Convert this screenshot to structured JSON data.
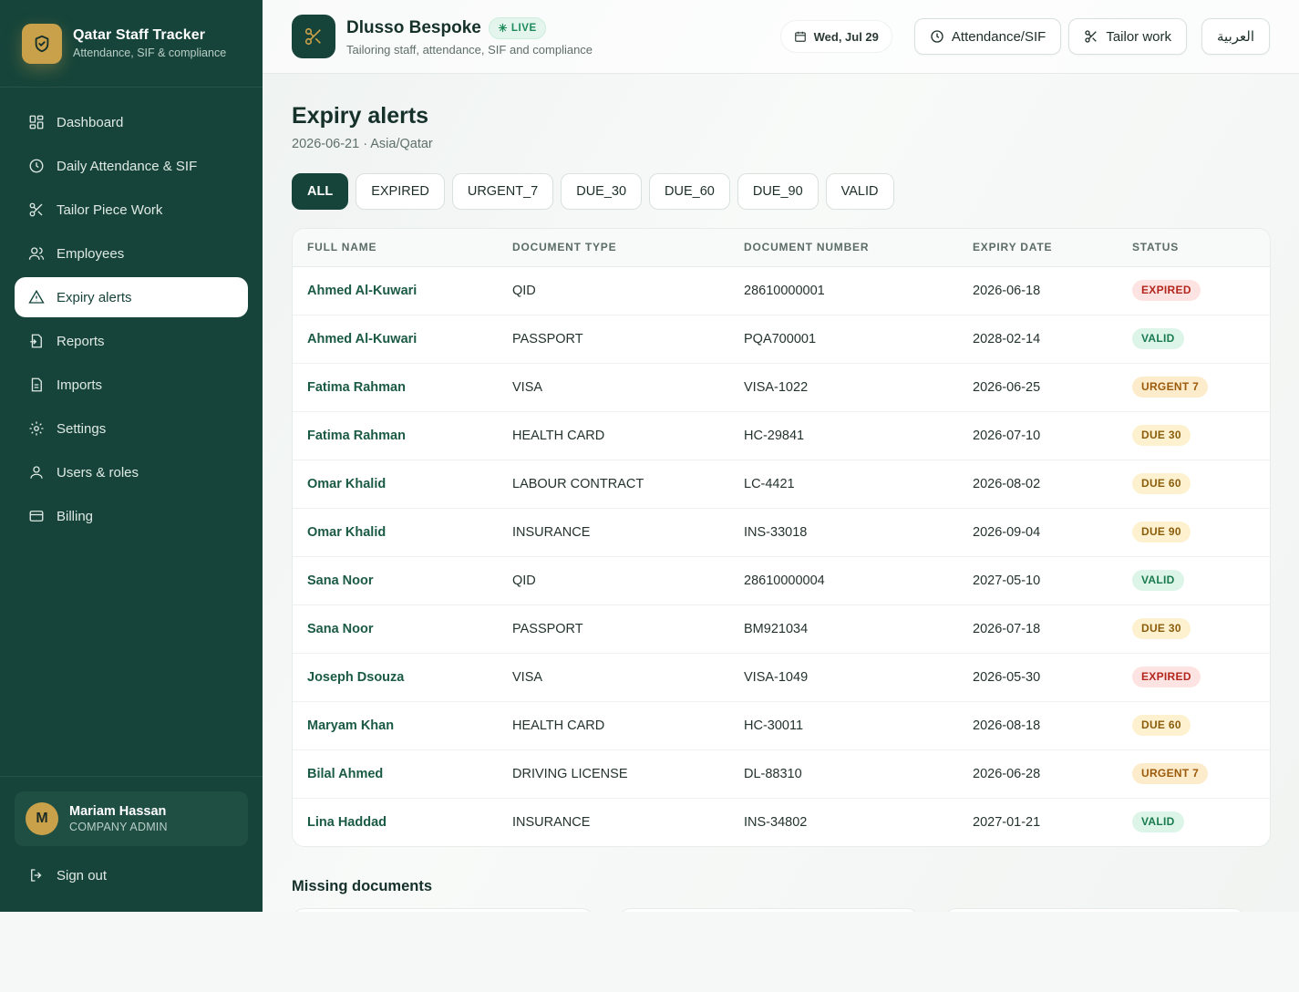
{
  "brand": {
    "title": "Qatar Staff Tracker",
    "subtitle": "Attendance, SIF & compliance"
  },
  "nav": [
    {
      "label": "Dashboard",
      "icon": "dashboard-icon",
      "active": false
    },
    {
      "label": "Daily Attendance & SIF",
      "icon": "clock-icon",
      "active": false
    },
    {
      "label": "Tailor Piece Work",
      "icon": "scissors-icon",
      "active": false
    },
    {
      "label": "Employees",
      "icon": "users-icon",
      "active": false
    },
    {
      "label": "Expiry alerts",
      "icon": "alert-triangle-icon",
      "active": true
    },
    {
      "label": "Reports",
      "icon": "report-icon",
      "active": false
    },
    {
      "label": "Imports",
      "icon": "import-icon",
      "active": false
    },
    {
      "label": "Settings",
      "icon": "gear-icon",
      "active": false
    },
    {
      "label": "Users & roles",
      "icon": "user-icon",
      "active": false
    },
    {
      "label": "Billing",
      "icon": "credit-card-icon",
      "active": false
    }
  ],
  "user": {
    "initial": "M",
    "name": "Mariam Hassan",
    "role": "COMPANY ADMIN",
    "signout": "Sign out"
  },
  "tenant": {
    "name": "Dlusso Bespoke",
    "live": "LIVE",
    "subtitle": "Tailoring staff, attendance, SIF and compliance"
  },
  "topbar": {
    "date": "Wed, Jul 29",
    "attendance_btn": "Attendance/SIF",
    "tailor_btn": "Tailor work",
    "lang_btn": "العربية"
  },
  "page": {
    "title": "Expiry alerts",
    "subtitle": "2026-06-21 · Asia/Qatar"
  },
  "filters": [
    "ALL",
    "EXPIRED",
    "URGENT_7",
    "DUE_30",
    "DUE_60",
    "DUE_90",
    "VALID"
  ],
  "table": {
    "headers": [
      "FULL NAME",
      "DOCUMENT TYPE",
      "DOCUMENT NUMBER",
      "EXPIRY DATE",
      "STATUS"
    ],
    "rows": [
      {
        "name": "Ahmed Al-Kuwari",
        "type": "QID",
        "number": "28610000001",
        "expiry": "2026-06-18",
        "status": "EXPIRED",
        "kind": "expired"
      },
      {
        "name": "Ahmed Al-Kuwari",
        "type": "PASSPORT",
        "number": "PQA700001",
        "expiry": "2028-02-14",
        "status": "VALID",
        "kind": "valid"
      },
      {
        "name": "Fatima Rahman",
        "type": "VISA",
        "number": "VISA-1022",
        "expiry": "2026-06-25",
        "status": "URGENT 7",
        "kind": "urgent"
      },
      {
        "name": "Fatima Rahman",
        "type": "HEALTH CARD",
        "number": "HC-29841",
        "expiry": "2026-07-10",
        "status": "DUE 30",
        "kind": "due"
      },
      {
        "name": "Omar Khalid",
        "type": "LABOUR CONTRACT",
        "number": "LC-4421",
        "expiry": "2026-08-02",
        "status": "DUE 60",
        "kind": "due"
      },
      {
        "name": "Omar Khalid",
        "type": "INSURANCE",
        "number": "INS-33018",
        "expiry": "2026-09-04",
        "status": "DUE 90",
        "kind": "due"
      },
      {
        "name": "Sana Noor",
        "type": "QID",
        "number": "28610000004",
        "expiry": "2027-05-10",
        "status": "VALID",
        "kind": "valid"
      },
      {
        "name": "Sana Noor",
        "type": "PASSPORT",
        "number": "BM921034",
        "expiry": "2026-07-18",
        "status": "DUE 30",
        "kind": "due"
      },
      {
        "name": "Joseph Dsouza",
        "type": "VISA",
        "number": "VISA-1049",
        "expiry": "2026-05-30",
        "status": "EXPIRED",
        "kind": "expired"
      },
      {
        "name": "Maryam Khan",
        "type": "HEALTH CARD",
        "number": "HC-30011",
        "expiry": "2026-08-18",
        "status": "DUE 60",
        "kind": "due"
      },
      {
        "name": "Bilal Ahmed",
        "type": "DRIVING LICENSE",
        "number": "DL-88310",
        "expiry": "2026-06-28",
        "status": "URGENT 7",
        "kind": "urgent"
      },
      {
        "name": "Lina Haddad",
        "type": "INSURANCE",
        "number": "INS-34802",
        "expiry": "2027-01-21",
        "status": "VALID",
        "kind": "valid"
      }
    ]
  },
  "missing": {
    "title": "Missing documents"
  },
  "colors": {
    "sidebar": "#16443a",
    "accent_gold": "#c9a14a",
    "expired": "#b3261e",
    "valid": "#197a4f",
    "due": "#8a5d0b"
  }
}
